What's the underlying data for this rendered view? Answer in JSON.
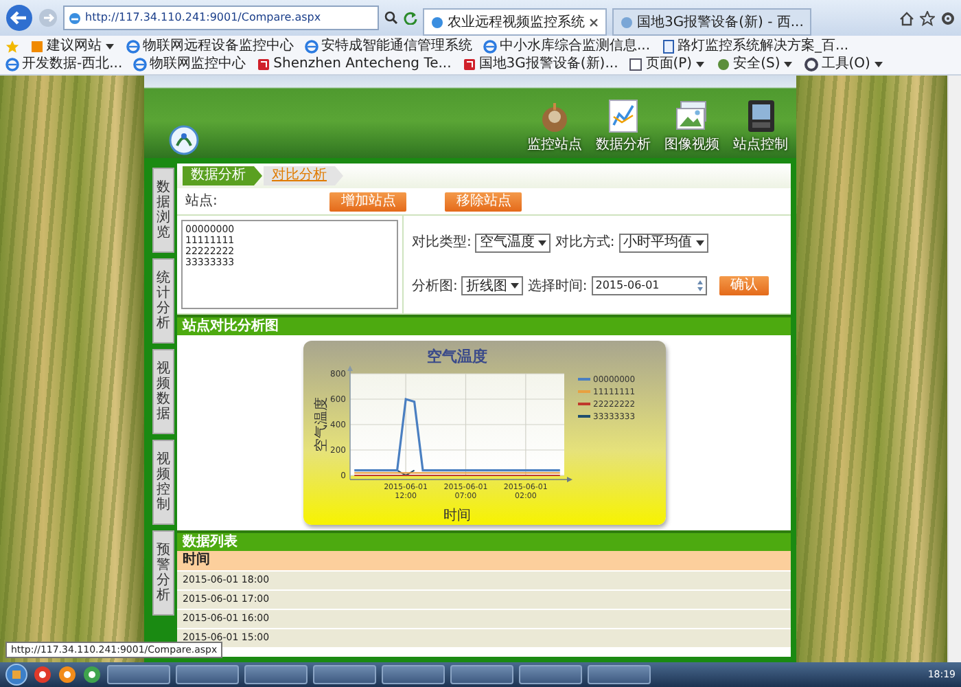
{
  "browser": {
    "address": "http://117.34.110.241:9001/Compare.aspx",
    "tabs": [
      {
        "label": "农业远程视频监控系统",
        "selected": true
      },
      {
        "label": "国地3G报警设备(新) - 西...",
        "selected": false
      }
    ],
    "favorites": [
      {
        "kind": "suggested",
        "label": "建议网站",
        "menu": true
      },
      {
        "kind": "ie",
        "label": "物联网远程设备监控中心",
        "menu": false
      },
      {
        "kind": "ie",
        "label": "安特成智能通信管理系统",
        "menu": false
      },
      {
        "kind": "ie",
        "label": "中小水库综合监测信息...",
        "menu": false
      },
      {
        "kind": "page",
        "label": "路灯监控系统解决方案_百...",
        "menu": false
      },
      {
        "kind": "ie",
        "label": "开发数据-西北...",
        "menu": false
      },
      {
        "kind": "ie",
        "label": "物联网监控中心",
        "menu": false
      },
      {
        "kind": "app",
        "label": "Shenzhen Antecheng Te...",
        "menu": false
      },
      {
        "kind": "app",
        "label": "国地3G报警设备(新)...",
        "menu": false
      }
    ],
    "commands": [
      "页面(P)",
      "安全(S)",
      "工具(O)"
    ]
  },
  "header": {
    "nav": [
      {
        "kind": "station",
        "label": "监控站点"
      },
      {
        "kind": "analysis",
        "label": "数据分析"
      },
      {
        "kind": "image",
        "label": "图像视频"
      },
      {
        "kind": "control",
        "label": "站点控制"
      }
    ]
  },
  "side_tabs": [
    "数据浏览",
    "统计分析",
    "视频数据",
    "视频控制",
    "预警分析"
  ],
  "breadcrumb": [
    {
      "label": "数据分析",
      "selected": false
    },
    {
      "label": "对比分析",
      "selected": true
    }
  ],
  "station_label": "站点:",
  "station_buttons": [
    "增加站点",
    "移除站点"
  ],
  "station_list": [
    "00000000",
    "11111111",
    "22222222",
    "33333333"
  ],
  "filters": [
    {
      "label": "对比类型:",
      "value": "空气温度"
    },
    {
      "label": "对比方式:",
      "value": "小时平均值"
    },
    {
      "label": "分析图:",
      "value": "折线图"
    }
  ],
  "date": {
    "label": "选择时间:",
    "value": "2015-06-01"
  },
  "confirm_button": "确认",
  "chart_section": {
    "title": "站点对比分析图",
    "chart_data": {
      "type": "line",
      "title": "空气温度",
      "xlabel": "时间",
      "ylabel": "空气温度",
      "categories": [
        null,
        null,
        null,
        null,
        null,
        null,
        "2015-06-01 12:00",
        null,
        null,
        null,
        null,
        null,
        null,
        "2015-06-01 07:00",
        null,
        null,
        null,
        null,
        null,
        null,
        "2015-06-01 02:00",
        null,
        null,
        null,
        null
      ],
      "grid": true,
      "legend": true,
      "ylim": [
        0,
        800
      ],
      "yticks": [
        0,
        200,
        400,
        600,
        800
      ],
      "series": [
        {
          "name": "00000000",
          "color": "#4a7fc1",
          "values": [
            40,
            40,
            40,
            40,
            40,
            40,
            600,
            580,
            40,
            40,
            40,
            40,
            40,
            40,
            40,
            40,
            40,
            40,
            40,
            40,
            40,
            40,
            40,
            40,
            40
          ]
        },
        {
          "name": "11111111",
          "color": "#e8a040",
          "values": [
            20,
            20,
            20,
            20,
            20,
            20,
            20,
            20,
            20,
            20,
            20,
            20,
            20,
            20,
            20,
            20,
            20,
            20,
            20,
            20,
            20,
            20,
            20,
            20,
            20
          ]
        },
        {
          "name": "22222222",
          "color": "#c0392b",
          "values": [
            0,
            0,
            0,
            0,
            0,
            0,
            0,
            0,
            0,
            0,
            0,
            0,
            0,
            0,
            0,
            0,
            0,
            0,
            0,
            0,
            0,
            0,
            0,
            0,
            0
          ]
        },
        {
          "name": "33333333",
          "color": "#1f4e6e",
          "values": [
            null,
            null,
            null,
            null,
            null,
            40,
            0,
            40,
            null,
            null,
            null,
            null,
            null,
            null,
            null,
            null,
            null,
            null,
            null,
            null,
            null,
            null,
            null,
            null,
            null
          ]
        }
      ]
    }
  },
  "data_section": {
    "title": "数据列表",
    "columns": [
      "时间"
    ],
    "rows": [
      [
        "2015-06-01 18:00"
      ],
      [
        "2015-06-01 17:00"
      ],
      [
        "2015-06-01 16:00"
      ],
      [
        "2015-06-01 15:00"
      ]
    ]
  },
  "status_tooltip": "http://117.34.110.241:9001/Compare.aspx",
  "taskbar": {
    "clock": "18:19"
  }
}
